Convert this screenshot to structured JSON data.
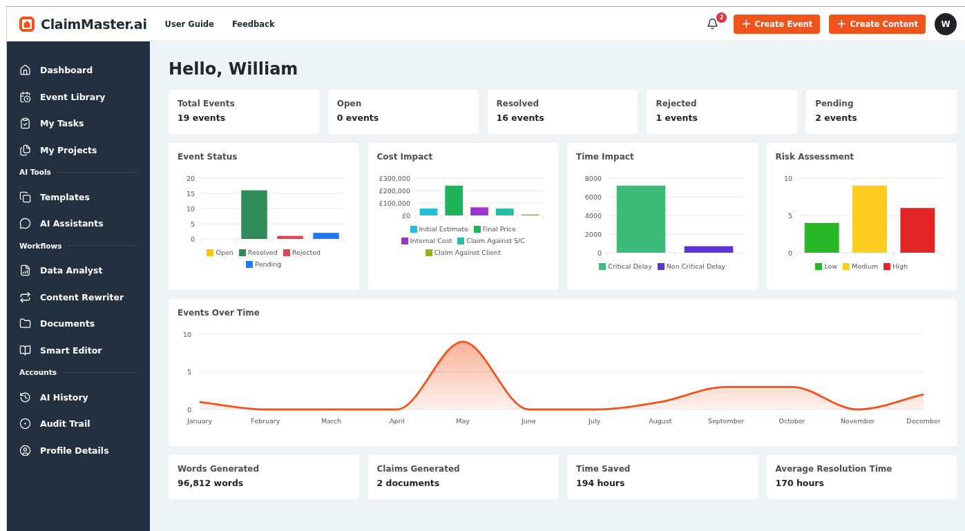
{
  "app": {
    "brand": "ClaimMaster.ai",
    "nav_links": [
      "User Guide",
      "Feedback"
    ],
    "notifications": "2",
    "buttons": [
      {
        "icon": "+",
        "label": "Create Event"
      },
      {
        "icon": "+",
        "label": "Create Content"
      }
    ],
    "avatar": "W"
  },
  "sidebar": {
    "sections": [
      {
        "items": [
          "Dashboard",
          "Event Library",
          "My Tasks",
          "My Projects"
        ]
      },
      {
        "title": "AI Tools",
        "items": [
          "Templates",
          "AI Assistants"
        ]
      },
      {
        "title": "Workflows",
        "items": [
          "Data Analyst",
          "Content Rewriter",
          "Documents",
          "Smart Editor"
        ]
      },
      {
        "title": "Accounts",
        "items": [
          "AI History",
          "Audit Trail",
          "Profile Details"
        ]
      }
    ]
  },
  "greeting": "Hello, William",
  "stats": [
    {
      "label": "Total Events",
      "value": "19 events"
    },
    {
      "label": "Open",
      "value": "0 events"
    },
    {
      "label": "Resolved",
      "value": "16 events"
    },
    {
      "label": "Rejected",
      "value": "1 events"
    },
    {
      "label": "Pending",
      "value": "2 events"
    }
  ],
  "charts": [
    {
      "chart_data": {
        "type": "bar",
        "title": "Event Status",
        "grid": true,
        "legend": "bottom",
        "ylim": [
          0,
          20
        ],
        "yticks": [
          0,
          5,
          10,
          15,
          20
        ],
        "series": [
          {
            "name": "Open",
            "color": "#ffc107",
            "values": [
              0
            ]
          },
          {
            "name": "Resolved",
            "color": "#2e8b57",
            "values": [
              16
            ]
          },
          {
            "name": "Rejected",
            "color": "#e04454",
            "values": [
              1
            ]
          },
          {
            "name": "Pending",
            "color": "#1e7bf5",
            "values": [
              2
            ]
          }
        ]
      }
    },
    {
      "chart_data": {
        "type": "bar",
        "title": "Cost Impact",
        "grid": true,
        "legend": "bottom",
        "ylim": [
          0,
          300000
        ],
        "yticks": [
          {
            "value": 0,
            "label": "£0"
          },
          {
            "value": 100000,
            "label": "£100,000"
          },
          {
            "value": 200000,
            "label": "£200,000"
          },
          {
            "value": 300000,
            "label": "£300,000"
          }
        ],
        "series": [
          {
            "name": "Initial Estimate",
            "color": "#22bcd4",
            "values": [
              55000
            ]
          },
          {
            "name": "Final Price",
            "color": "#1db45a",
            "values": [
              240000
            ]
          },
          {
            "name": "Internal Cost",
            "color": "#9b36d0",
            "values": [
              65000
            ]
          },
          {
            "name": "Claim Against S/C",
            "color": "#26bfa6",
            "values": [
              55000
            ]
          },
          {
            "name": "Claim Against Client",
            "color": "#9aad1a",
            "values": [
              8000
            ]
          }
        ]
      }
    },
    {
      "chart_data": {
        "type": "bar",
        "title": "Time Impact",
        "grid": true,
        "legend": "bottom",
        "ylim": [
          0,
          8000
        ],
        "yticks": [
          0,
          2000,
          4000,
          6000,
          8000
        ],
        "series": [
          {
            "name": "Critical Delay",
            "color": "#3dbb7b",
            "values": [
              7200
            ]
          },
          {
            "name": "Non Critical Delay",
            "color": "#5c35cf",
            "values": [
              700
            ]
          }
        ]
      }
    },
    {
      "chart_data": {
        "type": "bar",
        "title": "Risk Assessment",
        "grid": true,
        "legend": "bottom",
        "ylim": [
          0,
          10
        ],
        "yticks": [
          0,
          5,
          10
        ],
        "series": [
          {
            "name": "Low",
            "color": "#28b828",
            "values": [
              4
            ]
          },
          {
            "name": "Medium",
            "color": "#ffcc22",
            "values": [
              9
            ]
          },
          {
            "name": "High",
            "color": "#e32626",
            "values": [
              6
            ]
          }
        ]
      }
    }
  ],
  "timeline": {
    "chart_data": {
      "type": "area",
      "title": "Events Over Time",
      "grid": true,
      "categories": [
        "January",
        "February",
        "March",
        "April",
        "May",
        "June",
        "July",
        "August",
        "September",
        "October",
        "November",
        "December"
      ],
      "series": [
        {
          "color": "#f0531c",
          "values": [
            1,
            0,
            0,
            0,
            9,
            0,
            0,
            1,
            3,
            3,
            0,
            2
          ]
        }
      ],
      "ylim": [
        0,
        10
      ],
      "yticks": [
        0,
        5,
        10
      ]
    }
  },
  "summary": [
    {
      "label": "Words Generated",
      "value": "96,812 words"
    },
    {
      "label": "Claims Generated",
      "value": "2 documents"
    },
    {
      "label": "Time Saved",
      "value": "194 hours"
    },
    {
      "label": "Average Resolution Time",
      "value": "170 hours"
    }
  ]
}
